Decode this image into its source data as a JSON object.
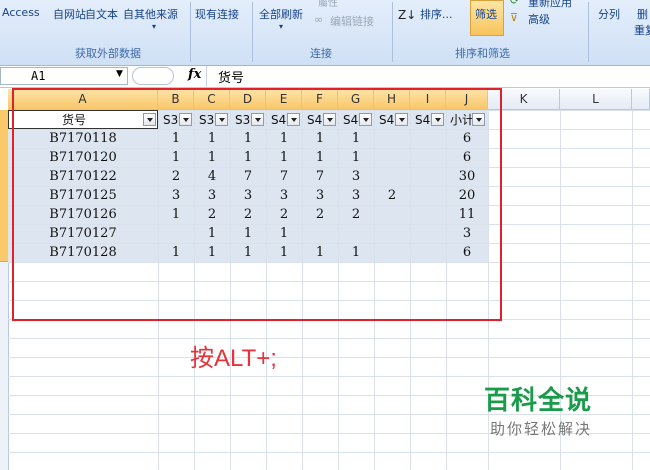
{
  "ribbon": {
    "items": {
      "access": "Access",
      "web": "自网站",
      "text": "自文本",
      "other": "自其他来源",
      "existing": "现有连接",
      "refresh_all": "全部刷新",
      "props": "屬性",
      "edit_links": "编辑链接",
      "sort": "排序...",
      "filter": "筛选",
      "reapply": "重新应用",
      "advanced": "高级",
      "split": "分列",
      "delete_dup_1": "删",
      "delete_dup_2": "重复"
    },
    "groups": {
      "external": "获取外部数据",
      "connections": "连接",
      "sort_filter": "排序和筛选"
    }
  },
  "formula_bar": {
    "name_box": "A1",
    "fx": "fx",
    "content": "货号"
  },
  "columns": [
    "A",
    "B",
    "C",
    "D",
    "E",
    "F",
    "G",
    "H",
    "I",
    "J",
    "K",
    "L"
  ],
  "header_row": [
    "货号",
    "S3",
    "S3",
    "S3",
    "S4",
    "S4",
    "S4",
    "S4",
    "S4",
    "小计"
  ],
  "rows": [
    [
      "B7170118",
      "1",
      "1",
      "1",
      "1",
      "1",
      "1",
      "",
      "",
      "6"
    ],
    [
      "B7170120",
      "1",
      "1",
      "1",
      "1",
      "1",
      "1",
      "",
      "",
      "6"
    ],
    [
      "B7170122",
      "2",
      "4",
      "7",
      "7",
      "7",
      "3",
      "",
      "",
      "30"
    ],
    [
      "B7170125",
      "3",
      "3",
      "3",
      "3",
      "3",
      "3",
      "2",
      "",
      "20"
    ],
    [
      "B7170126",
      "1",
      "2",
      "2",
      "2",
      "2",
      "2",
      "",
      "",
      "11"
    ],
    [
      "B7170127",
      "",
      "1",
      "1",
      "1",
      "",
      "",
      "",
      "",
      "3"
    ],
    [
      "B7170128",
      "1",
      "1",
      "1",
      "1",
      "1",
      "1",
      "",
      "",
      "6"
    ]
  ],
  "hint": "按ALT+;",
  "watermark": {
    "title": "百科全说",
    "subtitle": "助你轻松解决"
  },
  "colors": {
    "highlight": "#e0202a",
    "watermark_green": "#1a9b4a"
  }
}
